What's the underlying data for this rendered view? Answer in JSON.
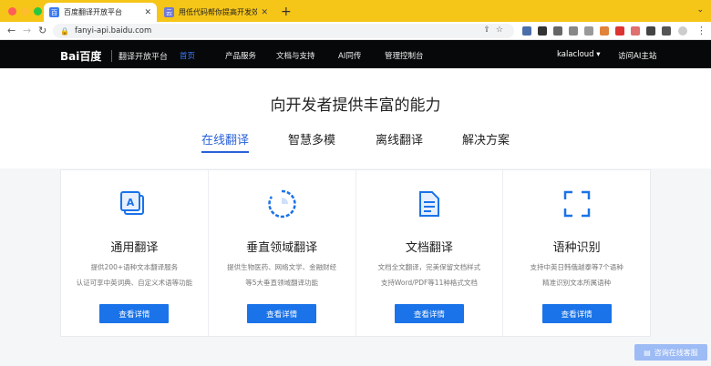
{
  "browser": {
    "tabs": [
      {
        "title": "百度翻译开放平台",
        "favicon": "百"
      },
      {
        "title": "用低代码帮你提高开发效率 - 千…",
        "favicon": "云"
      }
    ],
    "url": "fanyi-api.baidu.com",
    "new_tab": "+"
  },
  "site": {
    "logo": "Bai百度",
    "brand": "翻译开放平台",
    "nav": [
      "首页",
      "产品服务",
      "文档与支持",
      "AI同传",
      "管理控制台"
    ],
    "user": "kalacloud ▾",
    "ai_home": "访问AI主站"
  },
  "main": {
    "heading": "向开发者提供丰富的能力",
    "tabs": [
      "在线翻译",
      "智慧多模",
      "离线翻译",
      "解决方案"
    ],
    "cards": [
      {
        "title": "通用翻译",
        "desc1": "提供200+语种文本翻译服务",
        "desc2": "认证可享中英词典、自定义术语等功能",
        "button": "查看详情",
        "icon": "text-translate-icon"
      },
      {
        "title": "垂直领域翻译",
        "desc1": "提供生物医药、网络文学、金融财经",
        "desc2": "等5大垂直领域翻译功能",
        "button": "查看详情",
        "icon": "domain-circle-icon"
      },
      {
        "title": "文档翻译",
        "desc1": "文档全文翻译，完美保留文档样式",
        "desc2": "支持Word/PDF等11种格式文档",
        "button": "查看详情",
        "icon": "document-icon"
      },
      {
        "title": "语种识别",
        "desc1": "支持中英日韩俄越泰等7个语种",
        "desc2": "精准识别文本所属语种",
        "button": "查看详情",
        "icon": "scan-frame-icon"
      }
    ]
  },
  "chat": {
    "label": "咨询在线客服"
  },
  "colors": {
    "accent": "#1a73e8",
    "header_bg": "#070809",
    "tab_strip": "#f5c518"
  }
}
